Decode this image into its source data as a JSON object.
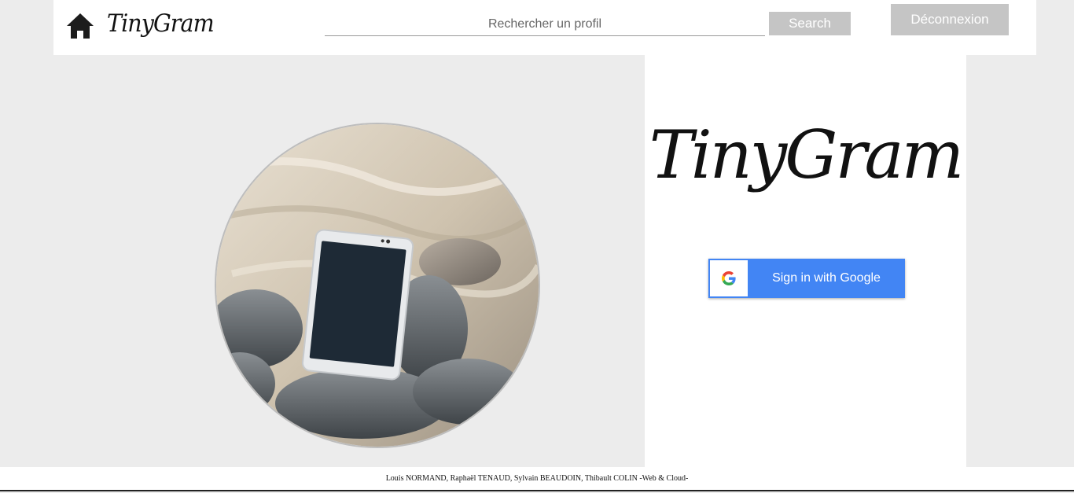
{
  "header": {
    "brand": "TinyGram",
    "search": {
      "placeholder": "Rechercher un profil",
      "value": ""
    },
    "search_button": "Search",
    "logout_button": "Déconnexion"
  },
  "hero": {
    "brand": "TinyGram",
    "google_signin_label": "Sign in with Google"
  },
  "footer": {
    "credits": "Louis NORMAND, Raphaël TENAUD, Sylvain BEAUDOIN, Thibault COLIN -Web & Cloud-"
  },
  "icons": {
    "home": "home-icon",
    "google": "google-g-icon"
  },
  "colors": {
    "page_background": "#ececec",
    "button_gray": "#c5c5c5",
    "google_blue": "#4285f4"
  }
}
